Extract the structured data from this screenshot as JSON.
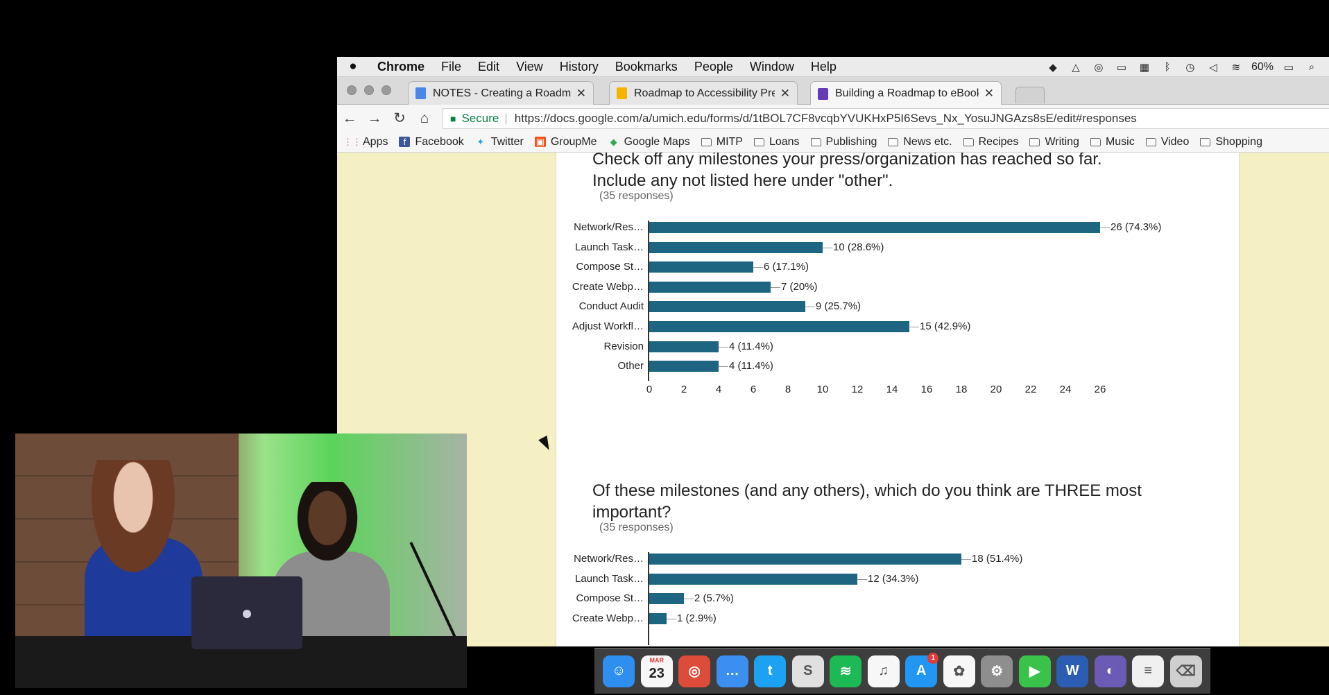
{
  "menubar": {
    "app": "Chrome",
    "items": [
      "File",
      "Edit",
      "View",
      "History",
      "Bookmarks",
      "People",
      "Window",
      "Help"
    ],
    "battery": "60%"
  },
  "tabs": [
    {
      "title": "NOTES - Creating a Roadmap t",
      "favicon_color": "#4a86e8",
      "active": false
    },
    {
      "title": "Roadmap to Accessibility Pres",
      "favicon_color": "#f4b400",
      "active": false
    },
    {
      "title": "Building a Roadmap to eBook A",
      "favicon_color": "#673ab7",
      "active": true
    }
  ],
  "address": {
    "secure_label": "Secure",
    "url": "https://docs.google.com/a/umich.edu/forms/d/1tBOL7CF8vcqbYVUKHxP5I6Sevs_Nx_YosuJNGAzs8sE/edit#responses"
  },
  "bookmarks": [
    {
      "label": "Apps",
      "icon": "apps-grid-icon"
    },
    {
      "label": "Facebook",
      "icon": "facebook-icon"
    },
    {
      "label": "Twitter",
      "icon": "twitter-icon"
    },
    {
      "label": "GroupMe",
      "icon": "groupme-icon"
    },
    {
      "label": "Google Maps",
      "icon": "google-maps-icon"
    },
    {
      "label": "MITP",
      "icon": "folder-icon"
    },
    {
      "label": "Loans",
      "icon": "folder-icon"
    },
    {
      "label": "Publishing",
      "icon": "folder-icon"
    },
    {
      "label": "News etc.",
      "icon": "folder-icon"
    },
    {
      "label": "Recipes",
      "icon": "folder-icon"
    },
    {
      "label": "Writing",
      "icon": "folder-icon"
    },
    {
      "label": "Music",
      "icon": "folder-icon"
    },
    {
      "label": "Video",
      "icon": "folder-icon"
    },
    {
      "label": "Shopping",
      "icon": "folder-icon"
    }
  ],
  "questions": [
    {
      "title_line1": "Check off any milestones your press/organization has reached so far.",
      "title_line2": "Include any not listed here under \"other\".",
      "responses": "(35 responses)"
    },
    {
      "title_line1": "Of these milestones (and any others), which do you think are THREE most",
      "title_line2": "important?",
      "responses": "(35 responses)"
    }
  ],
  "chart_data": [
    {
      "type": "bar",
      "orientation": "horizontal",
      "categories": [
        "Network/Res…",
        "Launch Task…",
        "Compose St…",
        "Create Webp…",
        "Conduct Audit",
        "Adjust Workfl…",
        "Revision",
        "Other"
      ],
      "values": [
        26,
        10,
        6,
        7,
        9,
        15,
        4,
        4
      ],
      "labels": [
        "26 (74.3%)",
        "10 (28.6%)",
        "6 (17.1%)",
        "7 (20%)",
        "9 (25.7%)",
        "15 (42.9%)",
        "4 (11.4%)",
        "4 (11.4%)"
      ],
      "xticks": [
        "0",
        "2",
        "4",
        "6",
        "8",
        "10",
        "12",
        "14",
        "16",
        "18",
        "20",
        "22",
        "24",
        "26"
      ],
      "xlim": [
        0,
        26
      ],
      "color": "#1d6581"
    },
    {
      "type": "bar",
      "orientation": "horizontal",
      "categories": [
        "Network/Res…",
        "Launch Task…",
        "Compose St…",
        "Create Webp…"
      ],
      "values": [
        18,
        12,
        2,
        1
      ],
      "labels": [
        "18 (51.4%)",
        "12 (34.3%)",
        "2 (5.7%)",
        "1 (2.9%)"
      ],
      "xlim": [
        0,
        26
      ],
      "color": "#1d6581"
    }
  ],
  "dock": [
    {
      "name": "finder-icon",
      "color": "#2f8ff0",
      "glyph": "☺"
    },
    {
      "name": "calendar-icon",
      "color": "#f7f7f7",
      "month": "MAR",
      "day": "23"
    },
    {
      "name": "chrome-icon",
      "color": "#dd4b39",
      "glyph": "◎"
    },
    {
      "name": "messenger-icon",
      "color": "#3b8ff0",
      "glyph": "…"
    },
    {
      "name": "twitter-icon",
      "color": "#1da1f2",
      "glyph": "t"
    },
    {
      "name": "scrivener-icon",
      "color": "#e0e0e0",
      "glyph": "S"
    },
    {
      "name": "spotify-icon",
      "color": "#1db954",
      "glyph": "≋"
    },
    {
      "name": "itunes-icon",
      "color": "#f7f7f7",
      "glyph": "♫"
    },
    {
      "name": "app-store-icon",
      "color": "#2196f3",
      "glyph": "A",
      "badge": "1"
    },
    {
      "name": "photos-icon",
      "color": "#f7f7f7",
      "glyph": "✿"
    },
    {
      "name": "system-preferences-icon",
      "color": "#8e8e8e",
      "glyph": "⚙"
    },
    {
      "name": "facetime-icon",
      "color": "#3ac34b",
      "glyph": "▶"
    },
    {
      "name": "word-icon",
      "color": "#2b5eb3",
      "glyph": "W"
    },
    {
      "name": "cyberduck-icon",
      "color": "#6b5bb5",
      "glyph": "◐"
    },
    {
      "name": "documents-icon",
      "color": "#f0f0f0",
      "glyph": "≡"
    },
    {
      "name": "trash-icon",
      "color": "#cfcfcf",
      "glyph": "⌫"
    }
  ]
}
